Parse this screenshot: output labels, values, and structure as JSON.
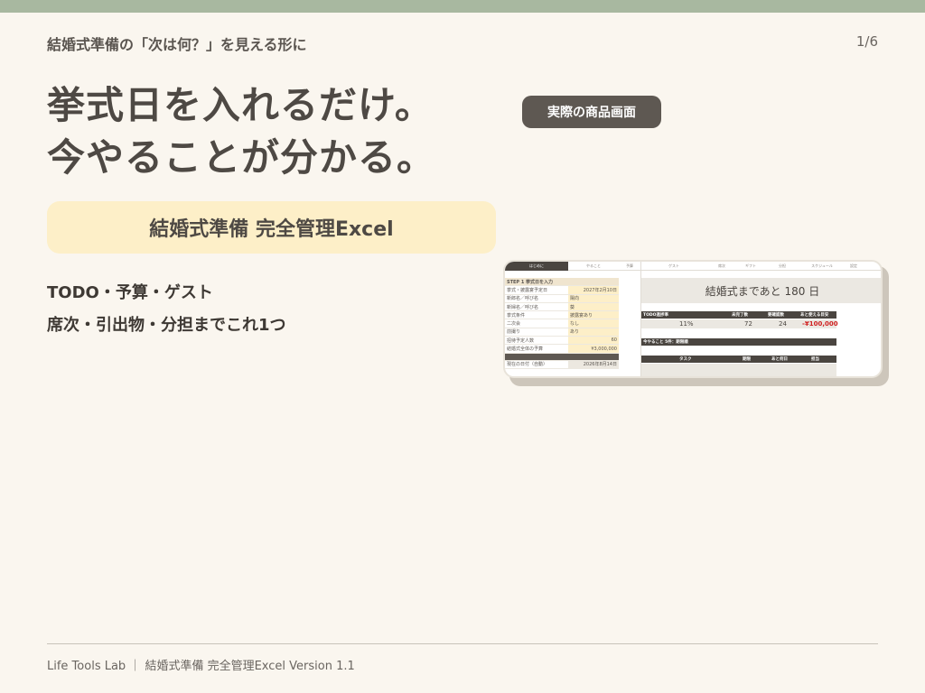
{
  "header": {
    "subtitle": "結婚式準備の「次は何？」を見える形に",
    "page_number": "1/6"
  },
  "headline": {
    "line1": "挙式日を入れるだけ。",
    "line2": "今やることが分かる。"
  },
  "badge_label": "実際の商品画面",
  "banner_label": "結婚式準備 完全管理Excel",
  "features": [
    "TODO・予算・ゲスト",
    "席次・引出物・分担までこれ1つ"
  ],
  "screenshot": {
    "tabs": [
      "はじめに",
      "やること",
      "予算",
      "ゲスト",
      "席次",
      "ギフト",
      "分担",
      "スケジュール",
      "設定"
    ],
    "left": {
      "step_label": "STEP 1  挙式日を入力",
      "rows": [
        {
          "label": "挙式・披露宴予定日",
          "value": "2027年2月10日"
        },
        {
          "label": "新郎名／呼び名",
          "value": "陽向"
        },
        {
          "label": "新婦名／呼び名",
          "value": "葵"
        },
        {
          "label": "挙式条件",
          "value": "披露宴あり"
        },
        {
          "label": "二次会",
          "value": "なし"
        },
        {
          "label": "前撮り",
          "value": "あり"
        },
        {
          "label": "招待予定人数",
          "value": "60"
        },
        {
          "label": "結婚式全体の予算",
          "value": "¥3,000,000"
        }
      ],
      "today_label": "現在の日付（自動）",
      "today_value": "2026年8月14日"
    },
    "countdown": "結婚式まであと 180 日",
    "summary_headers": [
      "TODO進捗率",
      "未完了数",
      "要確認数",
      "あと使える目安"
    ],
    "summary_values": [
      "11%",
      "72",
      "24",
      "-¥100,000"
    ],
    "todo_section_label": "今やること 5件：期限順",
    "todo_headers": [
      "タスク",
      "期限",
      "あと何日",
      "担当"
    ]
  },
  "footer": "Life Tools Lab ｜ 結婚式準備 完全管理Excel  Version 1.1",
  "colors": {
    "top_bar": "#a8b8a0",
    "background": "#faf6ef",
    "badge": "#5e5852",
    "banner": "#fdefc8",
    "negative": "#d02020"
  }
}
